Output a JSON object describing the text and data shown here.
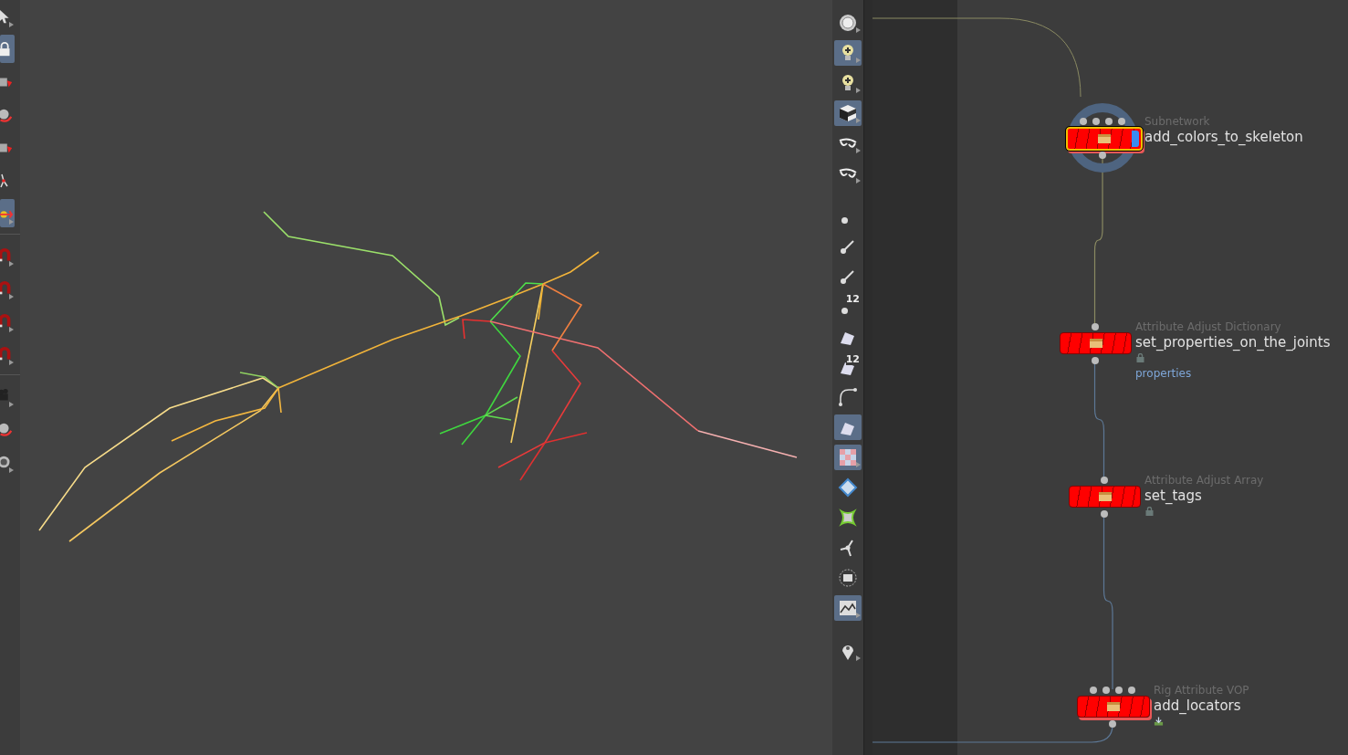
{
  "left_toolbar": {
    "groups": [
      [
        {
          "selected": false,
          "menu": true
        },
        {
          "selected": true,
          "menu": false
        },
        {
          "selected": false,
          "menu": false
        },
        {
          "selected": false,
          "menu": false
        },
        {
          "selected": false,
          "menu": false
        },
        {
          "selected": false,
          "menu": false
        },
        {
          "selected": true,
          "menu": true
        }
      ],
      [
        {
          "selected": false,
          "menu": true
        },
        {
          "selected": false,
          "menu": true
        },
        {
          "selected": false,
          "menu": true
        },
        {
          "selected": false,
          "menu": true
        }
      ],
      [
        {
          "selected": false,
          "menu": true
        },
        {
          "selected": false,
          "menu": false
        },
        {
          "selected": false,
          "menu": true
        }
      ]
    ]
  },
  "right_toolbar": {
    "groups": [
      [
        {
          "selected": false,
          "menu": true
        },
        {
          "selected": true,
          "menu": true
        },
        {
          "selected": false,
          "menu": true
        },
        {
          "selected": true,
          "menu": true
        },
        {
          "selected": false,
          "menu": true
        },
        {
          "selected": false,
          "menu": true
        }
      ],
      [
        {
          "selected": false,
          "menu": false
        },
        {
          "selected": false,
          "menu": false
        },
        {
          "selected": false,
          "menu": false
        },
        {
          "selected": false,
          "menu": false,
          "badge": "12"
        },
        {
          "selected": false,
          "menu": false
        },
        {
          "selected": false,
          "menu": false,
          "badge": "12"
        },
        {
          "selected": false,
          "menu": false
        },
        {
          "selected": true,
          "menu": false
        },
        {
          "selected": true,
          "menu": true
        },
        {
          "selected": false,
          "menu": false
        },
        {
          "selected": false,
          "menu": false
        },
        {
          "selected": false,
          "menu": false
        },
        {
          "selected": false,
          "menu": false
        },
        {
          "selected": true,
          "menu": true
        }
      ],
      [
        {
          "selected": false,
          "menu": true
        }
      ]
    ]
  },
  "network": {
    "nodes": [
      {
        "type": "Subnetwork",
        "name": "add_colors_to_skeleton",
        "selected": true,
        "current": true,
        "display": true,
        "highlight": true,
        "multi_input": true,
        "locked": false,
        "exported": false
      },
      {
        "type": "Attribute Adjust Dictionary",
        "name": "set_properties_on_the_joints",
        "selected": false,
        "current": false,
        "display": false,
        "highlight": false,
        "multi_input": false,
        "locked": true,
        "exported": false,
        "link": "properties"
      },
      {
        "type": "Attribute Adjust Array",
        "name": "set_tags",
        "selected": false,
        "current": false,
        "display": false,
        "highlight": false,
        "multi_input": false,
        "locked": true,
        "exported": false
      },
      {
        "type": "Rig Attribute VOP",
        "name": "add_locators",
        "selected": false,
        "current": false,
        "display": false,
        "highlight": true,
        "multi_input": true,
        "locked": false,
        "exported": true
      }
    ]
  }
}
